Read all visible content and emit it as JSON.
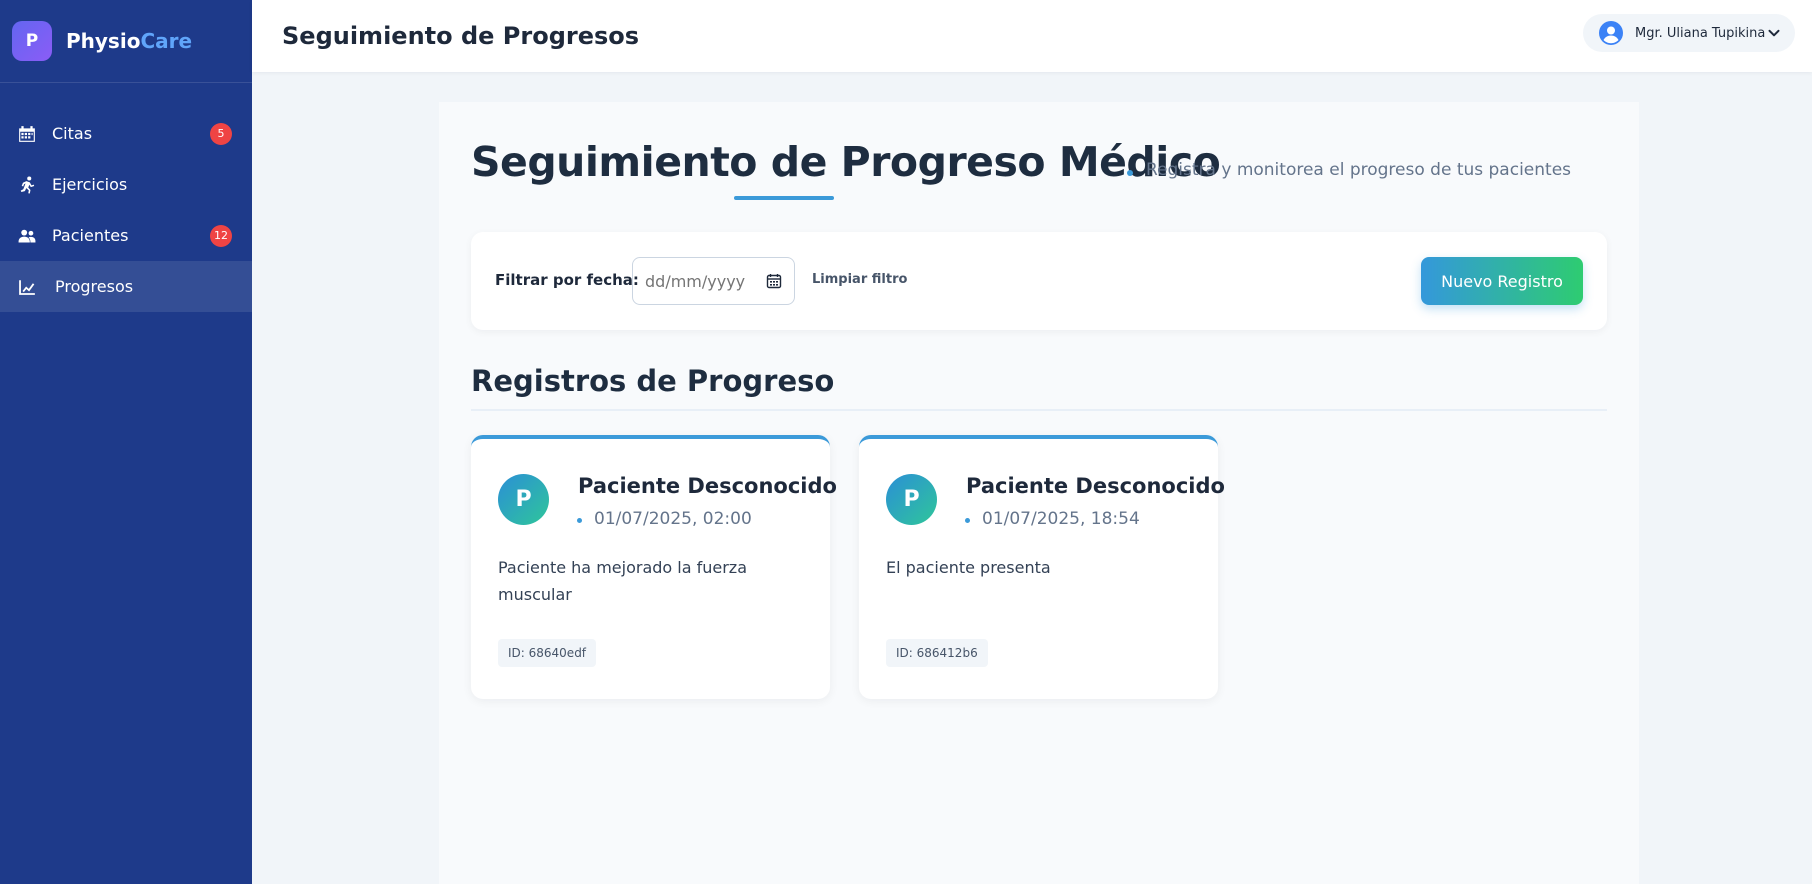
{
  "brand": {
    "logo_letter": "P",
    "name_part1": "Physio",
    "name_part2": "Care"
  },
  "sidebar": {
    "items": [
      {
        "label": "Citas",
        "icon": "calendar-icon",
        "badge": "5",
        "active": false
      },
      {
        "label": "Ejercicios",
        "icon": "running-icon",
        "badge": "",
        "active": false
      },
      {
        "label": "Pacientes",
        "icon": "users-icon",
        "badge": "12",
        "active": false
      },
      {
        "label": "Progresos",
        "icon": "chart-line-icon",
        "badge": "",
        "active": true
      }
    ]
  },
  "header": {
    "title": "Seguimiento de Progresos",
    "user_name": "Mgr. Uliana Tupikina",
    "user_icon": "user-circle-icon"
  },
  "main": {
    "title": "Seguimiento de Progreso Médico",
    "subtitle": "Registra y monitorea el progreso de tus pacientes",
    "filter": {
      "label": "Filtrar por fecha:",
      "date_placeholder": "dd/mm/yyyy",
      "clear_label": "Limpiar filtro",
      "new_button_label": "Nuevo Registro"
    },
    "section_title": "Registros de Progreso",
    "records": [
      {
        "avatar_letter": "P",
        "patient": "Paciente Desconocido",
        "date": "01/07/2025, 02:00",
        "text": "Paciente ha mejorado la fuerza muscular",
        "id": "ID: 68640edf"
      },
      {
        "avatar_letter": "P",
        "patient": "Paciente Desconocido",
        "date": "01/07/2025, 18:54",
        "text": "El paciente presenta",
        "id": "ID: 686412b6"
      }
    ]
  },
  "colors": {
    "sidebar_bg": "#1e3a8a",
    "accent": "#3b9ad9",
    "badge": "#ef4444",
    "button_gradient_start": "#3498db",
    "button_gradient_end": "#2ecc71"
  }
}
